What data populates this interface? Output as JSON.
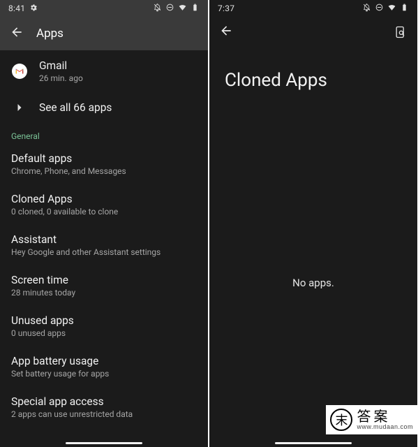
{
  "left": {
    "status_time": "8:41",
    "header_title": "Apps",
    "app_row": {
      "name": "Gmail",
      "sub": "26 min. ago"
    },
    "see_all": "See all 66 apps",
    "section_label": "General",
    "settings": [
      {
        "title": "Default apps",
        "sub": "Chrome, Phone, and Messages"
      },
      {
        "title": "Cloned Apps",
        "sub": "0 cloned, 0 available to clone"
      },
      {
        "title": "Assistant",
        "sub": "Hey Google and other Assistant settings"
      },
      {
        "title": "Screen time",
        "sub": "28 minutes today"
      },
      {
        "title": "Unused apps",
        "sub": "0 unused apps"
      },
      {
        "title": "App battery usage",
        "sub": "Set battery usage for apps"
      },
      {
        "title": "Special app access",
        "sub": "2 apps can use unrestricted data"
      }
    ]
  },
  "right": {
    "status_time": "7:37",
    "title": "Cloned Apps",
    "empty_text": "No apps."
  },
  "watermark": {
    "glyph": "末",
    "big": "答案",
    "small": "www.mudaan.com"
  }
}
